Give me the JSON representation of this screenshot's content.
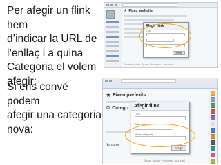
{
  "captions": {
    "top": "Per afegir un flink hem\nd’indicar la URL de\nl’enllaç i a quina\nCategoria el volem\nafegir:",
    "bottom": "Si ens convé podem\nafegir una categoria\nnova:"
  },
  "colors": {
    "highlight": "#f2a30f",
    "text": "#1a1a1a"
  },
  "shot1": {
    "section_title": "Fixeu preferits",
    "dialog_title": "Afegir flink",
    "dialog_field_label": "URL",
    "dialog_button": "Afegir",
    "footer": "Servei de fotos · Ajuda · Privadesa · Avís legal"
  },
  "shot2": {
    "section_title": "Fixeu preferits",
    "section_label_short": "Catego",
    "dialog_title": "Afegir flink",
    "dialog_field_label": "URL",
    "dialog_category_label": "Categoria",
    "new_category_label": "Nova categoria",
    "dialog_button": "Afegir",
    "name_label": "No nome",
    "footer": "Servei · Ajuda · Privadesa · Avís legal"
  },
  "icons": {
    "star": "star-icon",
    "gear": "gear-icon"
  }
}
